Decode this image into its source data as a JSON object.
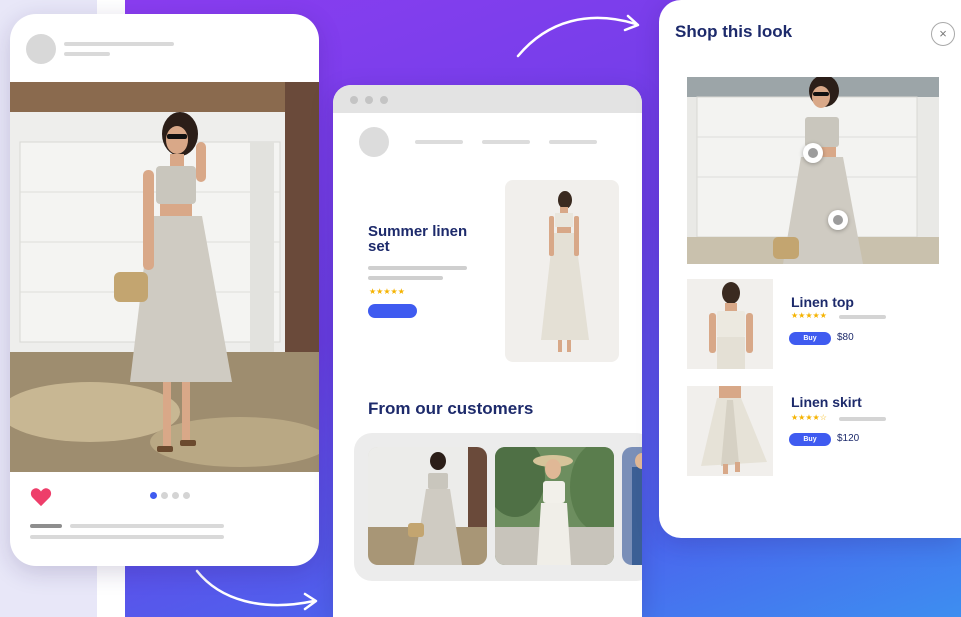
{
  "colors": {
    "accent": "#3f5bf0",
    "heading": "#1d2a6b",
    "heart": "#ee3e6a",
    "stars": "#f5b301",
    "gradient_start": "#8a3df0",
    "gradient_end": "#3d8ef0"
  },
  "phone_post": {
    "like_icon": "heart-icon",
    "carousel_dots": 4,
    "active_dot": 0
  },
  "product_page": {
    "title": "Summer linen set",
    "rating": "★★★★★",
    "customers_heading": "From our customers"
  },
  "shop_panel": {
    "title": "Shop this look",
    "close_icon": "×",
    "products": [
      {
        "name": "Linen top",
        "rating": "★★★★★",
        "buy_label": "Buy",
        "price": "$80"
      },
      {
        "name": "Linen skirt",
        "rating": "★★★★☆",
        "buy_label": "Buy",
        "price": "$120"
      }
    ]
  }
}
